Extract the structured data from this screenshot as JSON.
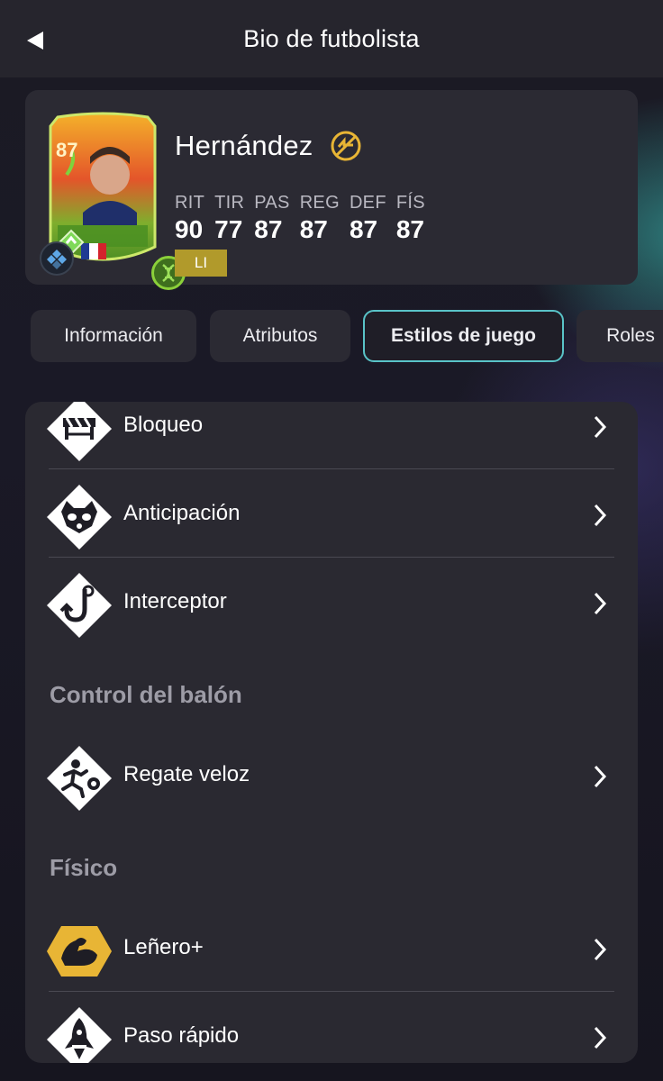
{
  "header": {
    "title": "Bio de futbolista"
  },
  "player": {
    "name": "Hernández",
    "rating": "87",
    "position_tag": "LI",
    "stats": [
      {
        "label": "RIT",
        "value": "90"
      },
      {
        "label": "TIR",
        "value": "77"
      },
      {
        "label": "PAS",
        "value": "87"
      },
      {
        "label": "REG",
        "value": "87"
      },
      {
        "label": "DEF",
        "value": "87"
      },
      {
        "label": "FÍS",
        "value": "87"
      }
    ]
  },
  "tabs": [
    {
      "label": "Información"
    },
    {
      "label": "Atributos"
    },
    {
      "label": "Estilos de juego"
    },
    {
      "label": "Roles"
    }
  ],
  "playstyles": {
    "defense_items": [
      {
        "label": "Bloqueo",
        "icon": "barrier-icon"
      },
      {
        "label": "Anticipación",
        "icon": "raccoon-icon"
      },
      {
        "label": "Interceptor",
        "icon": "hook-icon"
      }
    ],
    "ball_control": {
      "title": "Control del balón",
      "items": [
        {
          "label": "Regate veloz",
          "icon": "runner-ball-icon"
        }
      ]
    },
    "physical": {
      "title": "Físico",
      "items": [
        {
          "label": "Leñero+",
          "icon": "flexed-arm-icon"
        },
        {
          "label": "Paso rápido",
          "icon": "rocket-icon"
        }
      ]
    }
  },
  "colors": {
    "accent_tab_border": "#59c3c8",
    "position_tag_bg": "#b19a2b",
    "plus_playstyle_gold": "#e8b535"
  }
}
